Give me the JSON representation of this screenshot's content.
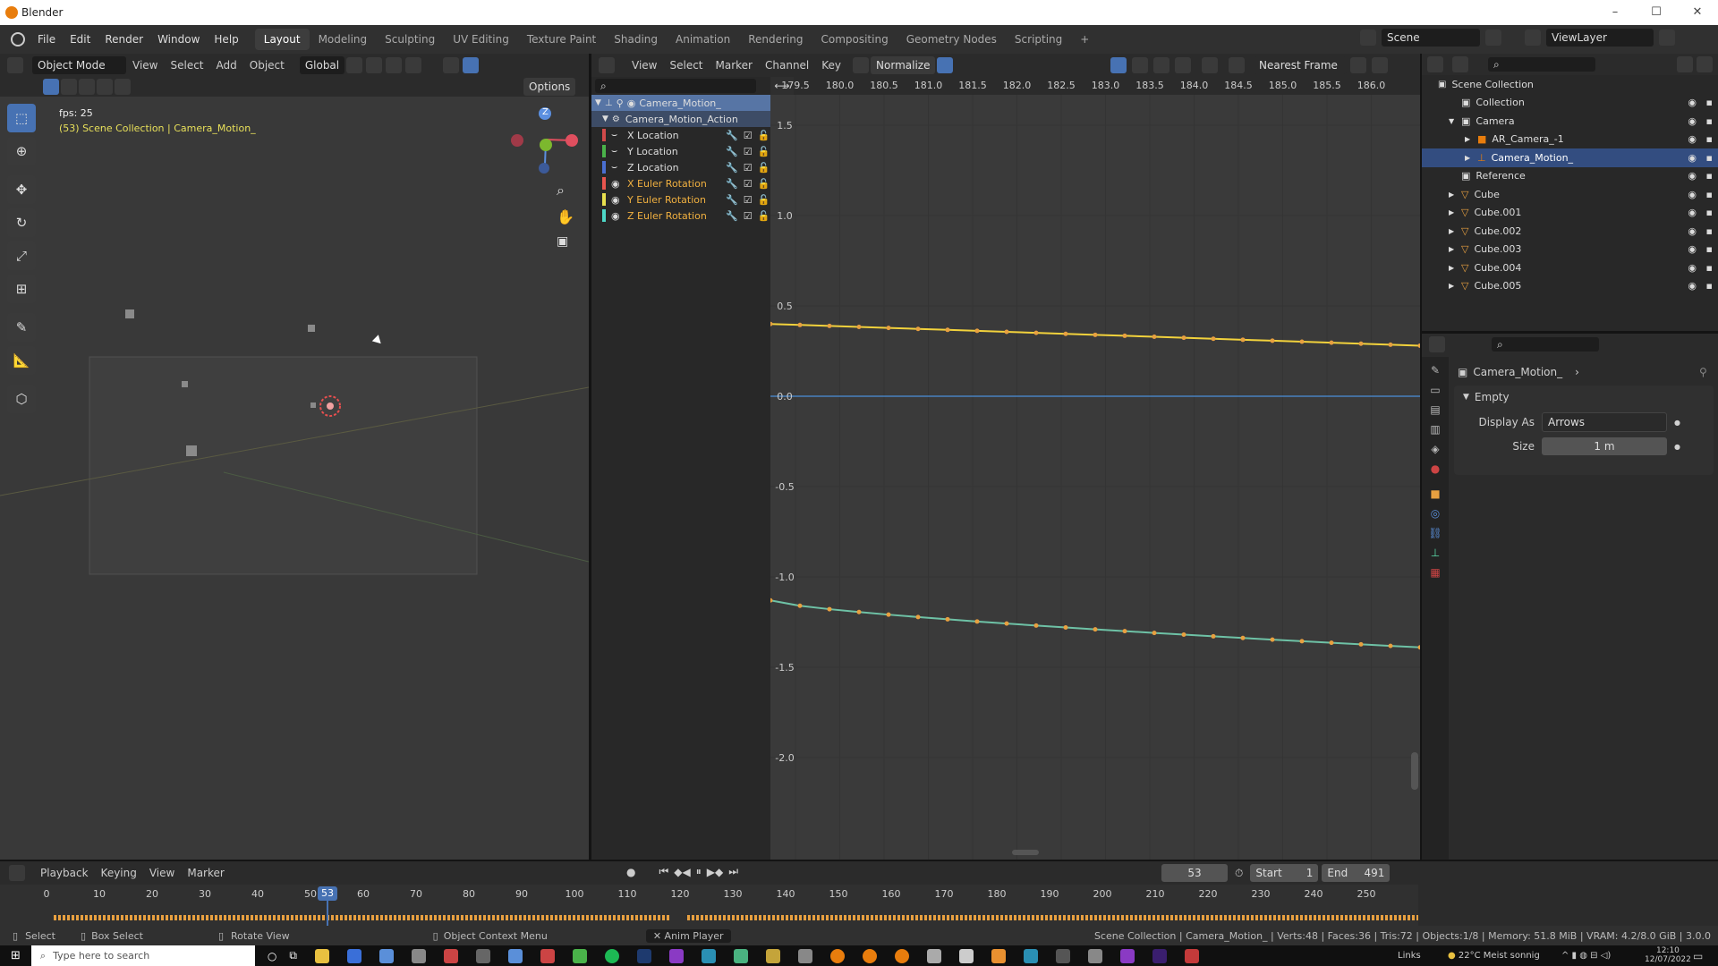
{
  "app": {
    "title": "Blender"
  },
  "menu": [
    "File",
    "Edit",
    "Render",
    "Window",
    "Help"
  ],
  "workspaces": [
    {
      "label": "Layout",
      "active": true
    },
    {
      "label": "Modeling"
    },
    {
      "label": "Sculpting"
    },
    {
      "label": "UV Editing"
    },
    {
      "label": "Texture Paint"
    },
    {
      "label": "Shading"
    },
    {
      "label": "Animation"
    },
    {
      "label": "Rendering"
    },
    {
      "label": "Compositing"
    },
    {
      "label": "Geometry Nodes"
    },
    {
      "label": "Scripting"
    },
    {
      "label": "+"
    }
  ],
  "scene": {
    "name": "Scene",
    "view_layer": "ViewLayer"
  },
  "viewport": {
    "mode": "Object Mode",
    "menus": [
      "View",
      "Select",
      "Add",
      "Object"
    ],
    "orientation": "Global",
    "options": "Options",
    "fps": "fps: 25",
    "info": "(53) Scene Collection | Camera_Motion_",
    "gizmo_z": "Z"
  },
  "graph": {
    "menus": [
      "View",
      "Select",
      "Marker",
      "Channel",
      "Key"
    ],
    "normalize": "Normalize",
    "interpolation": "Nearest Frame",
    "x_ticks": [
      "179.5",
      "180.0",
      "180.5",
      "181.0",
      "181.5",
      "182.0",
      "182.5",
      "183.0",
      "183.5",
      "184.0",
      "184.5",
      "185.0",
      "185.5",
      "186.0"
    ],
    "y_ticks": [
      "1.5",
      "1.0",
      "0.5",
      "0.0",
      "-0.5",
      "-1.0",
      "-1.5",
      "-2.0"
    ],
    "object": "Camera_Motion_",
    "action": "Camera_Motion_Action",
    "channels": [
      {
        "name": "X Location",
        "color": "#d14a4a",
        "visible": false
      },
      {
        "name": "Y Location",
        "color": "#4ab34a",
        "visible": false
      },
      {
        "name": "Z Location",
        "color": "#4a6fd1",
        "visible": false
      },
      {
        "name": "X Euler Rotation",
        "color": "#e8554e",
        "visible": true
      },
      {
        "name": "Y Euler Rotation",
        "color": "#e8e04e",
        "visible": true
      },
      {
        "name": "Z Euler Rotation",
        "color": "#4ed8c8",
        "visible": true
      }
    ],
    "curve_colors": {
      "y_rot": "#f2d23c",
      "x_rot": "#4a8fd9",
      "z_rot": "#6ec2a6",
      "key": "#e8a040"
    }
  },
  "outliner": {
    "root": "Scene Collection",
    "items": [
      {
        "label": "Collection",
        "indent": 1,
        "tri": false,
        "icon": "collection"
      },
      {
        "label": "Camera",
        "indent": 1,
        "tri": true,
        "open": true,
        "icon": "collection"
      },
      {
        "label": "AR_Camera_-1",
        "indent": 2,
        "tri": true,
        "icon": "camera"
      },
      {
        "label": "Camera_Motion_",
        "indent": 2,
        "tri": true,
        "icon": "empty",
        "selected": true
      },
      {
        "label": "Reference",
        "indent": 1,
        "tri": false,
        "icon": "collection"
      },
      {
        "label": "Cube",
        "indent": 1,
        "tri": true,
        "icon": "mesh"
      },
      {
        "label": "Cube.001",
        "indent": 1,
        "tri": true,
        "icon": "mesh"
      },
      {
        "label": "Cube.002",
        "indent": 1,
        "tri": true,
        "icon": "mesh"
      },
      {
        "label": "Cube.003",
        "indent": 1,
        "tri": true,
        "icon": "mesh"
      },
      {
        "label": "Cube.004",
        "indent": 1,
        "tri": true,
        "icon": "mesh"
      },
      {
        "label": "Cube.005",
        "indent": 1,
        "tri": true,
        "icon": "mesh"
      }
    ]
  },
  "properties": {
    "object": "Camera_Motion_",
    "panel": "Empty",
    "display_as_label": "Display As",
    "display_as": "Arrows",
    "size_label": "Size",
    "size": "1 m"
  },
  "timeline": {
    "menus": [
      "Playback",
      "Keying",
      "View",
      "Marker"
    ],
    "current": "53",
    "start_label": "Start",
    "start": "1",
    "end_label": "End",
    "end": "491",
    "ticks": [
      "0",
      "10",
      "20",
      "30",
      "40",
      "50",
      "60",
      "70",
      "80",
      "90",
      "100",
      "110",
      "120",
      "130",
      "140",
      "150",
      "160",
      "170",
      "180",
      "190",
      "200",
      "210",
      "220",
      "230",
      "240",
      "250"
    ]
  },
  "status": {
    "select": "Select",
    "box_select": "Box Select",
    "rotate": "Rotate View",
    "context": "Object Context Menu",
    "anim_player": "Anim Player",
    "stats": "Scene Collection | Camera_Motion_ | Verts:48 | Faces:36 | Tris:72 | Objects:1/8 | Memory: 51.8 MiB | VRAM: 4.2/8.0 GiB | 3.0.0"
  },
  "taskbar": {
    "search": "Type here to search",
    "links": "Links",
    "weather": "22°C  Meist sonnig",
    "time": "12:10",
    "date": "12/07/2022"
  }
}
